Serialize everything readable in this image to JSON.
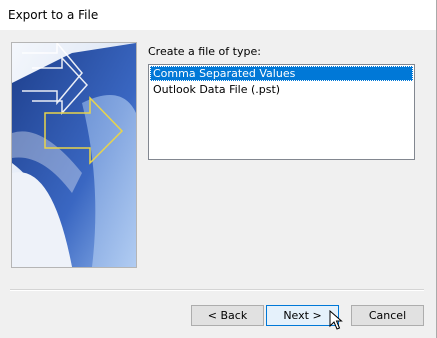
{
  "window": {
    "title": "Export to a File"
  },
  "file_type": {
    "label": "Create a file of type:",
    "options": [
      {
        "label": "Comma Separated Values",
        "selected": true
      },
      {
        "label": "Outlook Data File (.pst)",
        "selected": false
      }
    ]
  },
  "buttons": {
    "back": "< Back",
    "next": "Next >",
    "cancel": "Cancel"
  },
  "colors": {
    "selection": "#0078d7",
    "art_blue_dark": "#1e3f8c",
    "art_blue_light": "#a9c6ee",
    "art_arrow_yellow": "#e8d44a"
  },
  "icons": {
    "cursor": "mouse-pointer-icon"
  }
}
